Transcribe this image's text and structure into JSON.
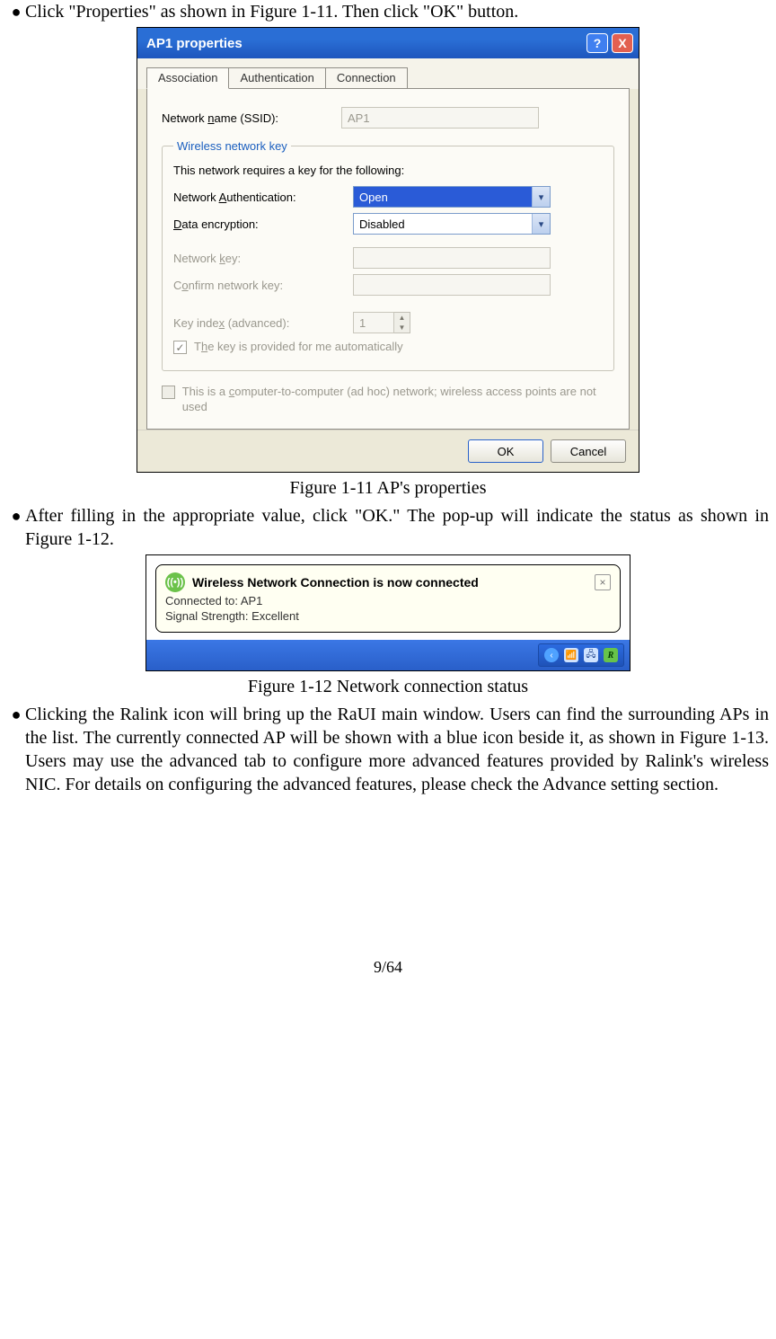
{
  "bullets": {
    "b1": "Click \"Properties\" as shown in Figure 1-11. Then click \"OK\" button.",
    "b2": "After filling in the appropriate value, click \"OK.\" The pop-up will indicate the status as shown in Figure 1-12.",
    "b3": "Clicking the Ralink icon will bring up the RaUI main window. Users can find the surrounding APs in the list. The currently connected AP will be shown with a blue icon beside it, as shown in Figure 1-13. Users may use the advanced tab to configure more advanced features provided by Ralink's wireless NIC. For details on configuring the advanced features, please check the Advance setting section."
  },
  "captions": {
    "c1": "Figure 1-11 AP's properties",
    "c2": "Figure 1-12 Network connection status"
  },
  "dialog": {
    "title": "AP1 properties",
    "help": "?",
    "close": "X",
    "tabs": {
      "t1": "Association",
      "t2": "Authentication",
      "t3": "Connection"
    },
    "ssid_label_pre": "Network ",
    "ssid_label_u": "n",
    "ssid_label_post": "ame (SSID):",
    "ssid_value": "AP1",
    "group_legend": "Wireless network key",
    "group_desc": "This network requires a key for the following:",
    "auth_label_pre": "Network ",
    "auth_label_u": "A",
    "auth_label_post": "uthentication:",
    "auth_value": "Open",
    "enc_label_u": "D",
    "enc_label_post": "ata encryption:",
    "enc_value": "Disabled",
    "key_label_pre": "Network ",
    "key_label_u": "k",
    "key_label_post": "ey:",
    "confirm_label_pre": "C",
    "confirm_label_u": "o",
    "confirm_label_post": "nfirm network key:",
    "index_label_pre": "Key inde",
    "index_label_u": "x",
    "index_label_post": " (advanced):",
    "index_value": "1",
    "auto_pre": "T",
    "auto_u": "h",
    "auto_post": "e key is provided for me automatically",
    "adhoc_pre": "This is a ",
    "adhoc_u": "c",
    "adhoc_post": "omputer-to-computer (ad hoc) network; wireless access points are not used",
    "ok": "OK",
    "cancel": "Cancel"
  },
  "notif": {
    "title": "Wireless Network Connection is now connected",
    "line1": "Connected to: AP1",
    "line2": "Signal Strength: Excellent",
    "close": "×",
    "icon": "((•))",
    "tray_back": "‹",
    "tray_r": "R"
  },
  "page": "9/64"
}
